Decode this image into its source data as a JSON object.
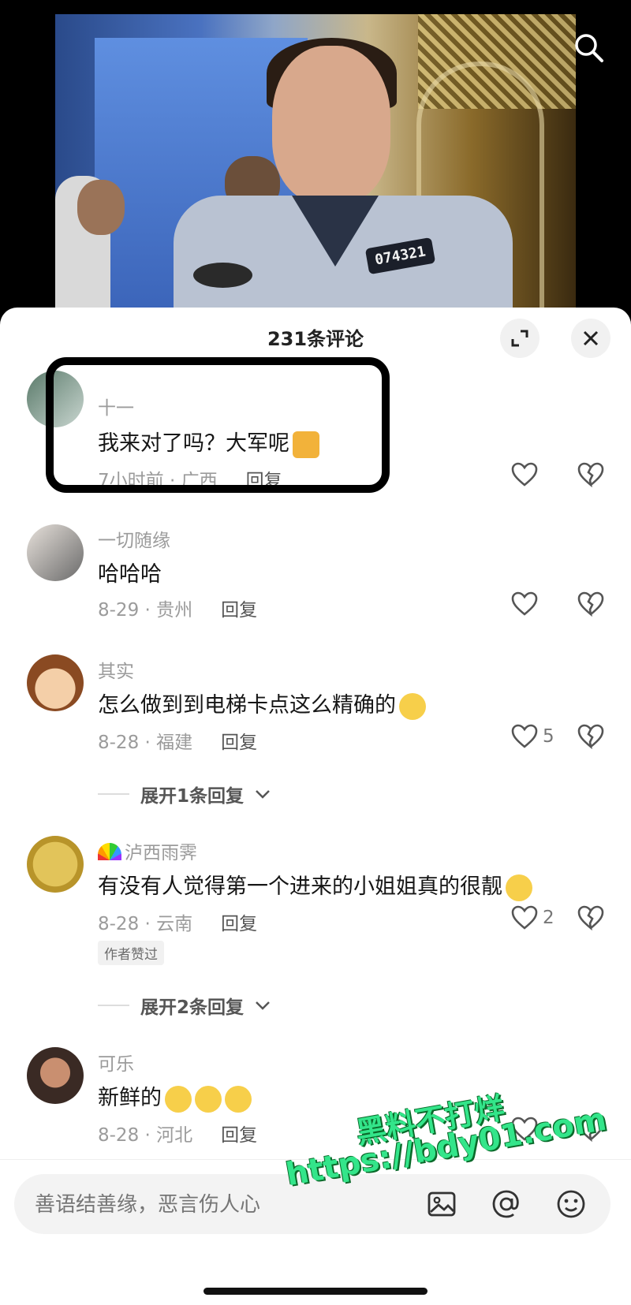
{
  "sheet": {
    "title": "231条评论"
  },
  "comments": [
    {
      "user": "十一",
      "text": "我来对了吗？大军呢",
      "meta": "7小时前 · 广西",
      "reply": "回复",
      "likes": ""
    },
    {
      "user": "一切随缘",
      "text": "哈哈哈",
      "meta": "8-29 · 贵州",
      "reply": "回复",
      "likes": ""
    },
    {
      "user": "其实",
      "text": "怎么做到到电梯卡点这么精确的",
      "meta": "8-28 · 福建",
      "reply": "回复",
      "likes": "5",
      "expand": "展开1条回复"
    },
    {
      "user": "泸西雨霁",
      "text": "有没有人觉得第一个进来的小姐姐真的很靓",
      "meta": "8-28 · 云南",
      "reply": "回复",
      "likes": "2",
      "tag": "作者赞过",
      "expand": "展开2条回复"
    },
    {
      "user": "可乐",
      "text": "新鲜的",
      "meta": "8-28 · 河北",
      "reply": "回复",
      "likes": ""
    }
  ],
  "video": {
    "badge": "074321"
  },
  "input": {
    "placeholder": "善语结善缘，恶言伤人心"
  },
  "watermark": {
    "line1": "黑料不打烊",
    "line2": "https://bdy01.com"
  },
  "colors": {
    "accent_watermark": "#33e58a",
    "sheet_bg": "#ffffff",
    "muted_text": "#9b9b9b"
  }
}
